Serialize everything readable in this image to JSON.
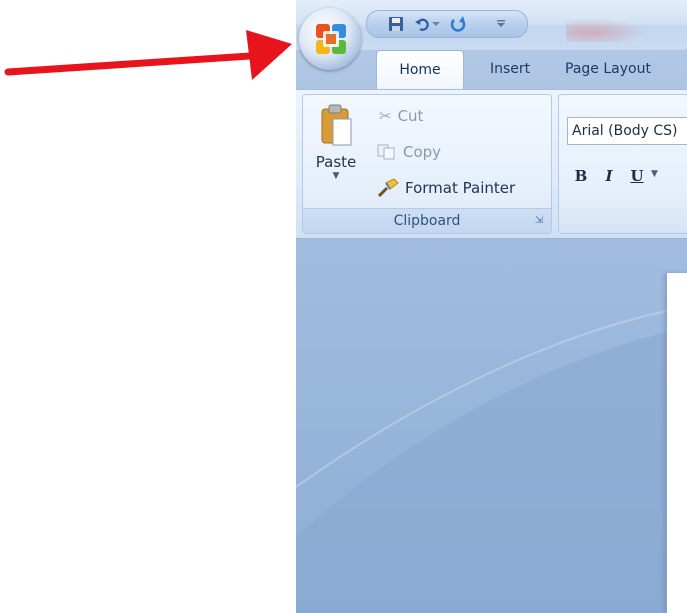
{
  "qat": {
    "items": [
      {
        "name": "save-icon"
      },
      {
        "name": "undo-icon"
      },
      {
        "name": "undo-dropdown-icon"
      },
      {
        "name": "redo-icon"
      },
      {
        "name": "customize-qat-icon"
      }
    ]
  },
  "tabs": [
    {
      "label": "Home",
      "active": true
    },
    {
      "label": "Insert",
      "active": false
    },
    {
      "label": "Page Layout",
      "active": false
    }
  ],
  "clipboard": {
    "paste_label": "Paste",
    "cut_label": "Cut",
    "copy_label": "Copy",
    "format_painter_label": "Format Painter",
    "group_label": "Clipboard"
  },
  "font": {
    "font_name": "Arial (Body CS)",
    "bold": "B",
    "italic": "I",
    "underline": "U"
  },
  "colors": {
    "arrow": "#e8141b",
    "ribbon_text": "#1c3a66"
  }
}
